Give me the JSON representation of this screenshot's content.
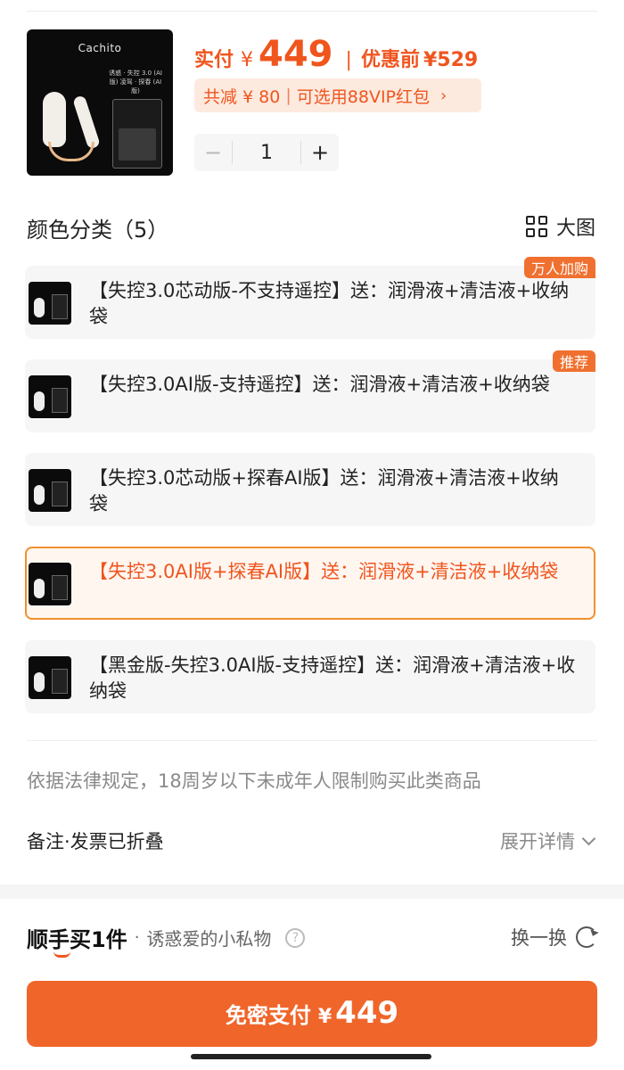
{
  "product": {
    "brand": "Cachito",
    "subtitle": "诱惑 · 失控 3.0 (AI版) 凌驾 · 探春 (AI版)"
  },
  "price": {
    "paid_label": "实付",
    "currency": "¥",
    "paid_value": "449",
    "separator": "|",
    "original_label": "优惠前",
    "original_value": "¥529"
  },
  "discount": {
    "total_saved": "共减 ¥ 80",
    "separator": "|",
    "vip_text": "可选用88VIP红包",
    "chevron": "›"
  },
  "quantity": {
    "minus": "−",
    "value": "1",
    "plus": "+"
  },
  "options_section": {
    "title": "颜色分类（5）",
    "big_image_label": "大图",
    "items": [
      {
        "text": "【失控3.0芯动版-不支持遥控】送：润滑液+清洁液+收纳袋",
        "badge": "万人加购",
        "selected": false
      },
      {
        "text": "【失控3.0AI版-支持遥控】送：润滑液+清洁液+收纳袋",
        "badge": "推荐",
        "selected": false
      },
      {
        "text": "【失控3.0芯动版+探春AI版】送：润滑液+清洁液+收纳袋",
        "badge": "",
        "selected": false
      },
      {
        "text": "【失控3.0AI版+探春AI版】送：润滑液+清洁液+收纳袋",
        "badge": "",
        "selected": true
      },
      {
        "text": "【黑金版-失控3.0AI版-支持遥控】送：润滑液+清洁液+收纳袋",
        "badge": "",
        "selected": false
      }
    ]
  },
  "legal_notice": "依据法律规定，18周岁以下未成年人限制购买此类商品",
  "remark": {
    "label": "备注·发票已折叠",
    "expand": "展开详情"
  },
  "bottom": {
    "logo_text": "顺手买1件",
    "dot": "·",
    "slogan": "诱惑爱的小私物",
    "help": "?",
    "swap_label": "换一换",
    "pay_label": "免密支付",
    "pay_currency": "¥",
    "pay_amount": "449"
  },
  "colors": {
    "accent": "#f0551e",
    "button": "#f0652a",
    "selected_border": "#f0902f"
  }
}
